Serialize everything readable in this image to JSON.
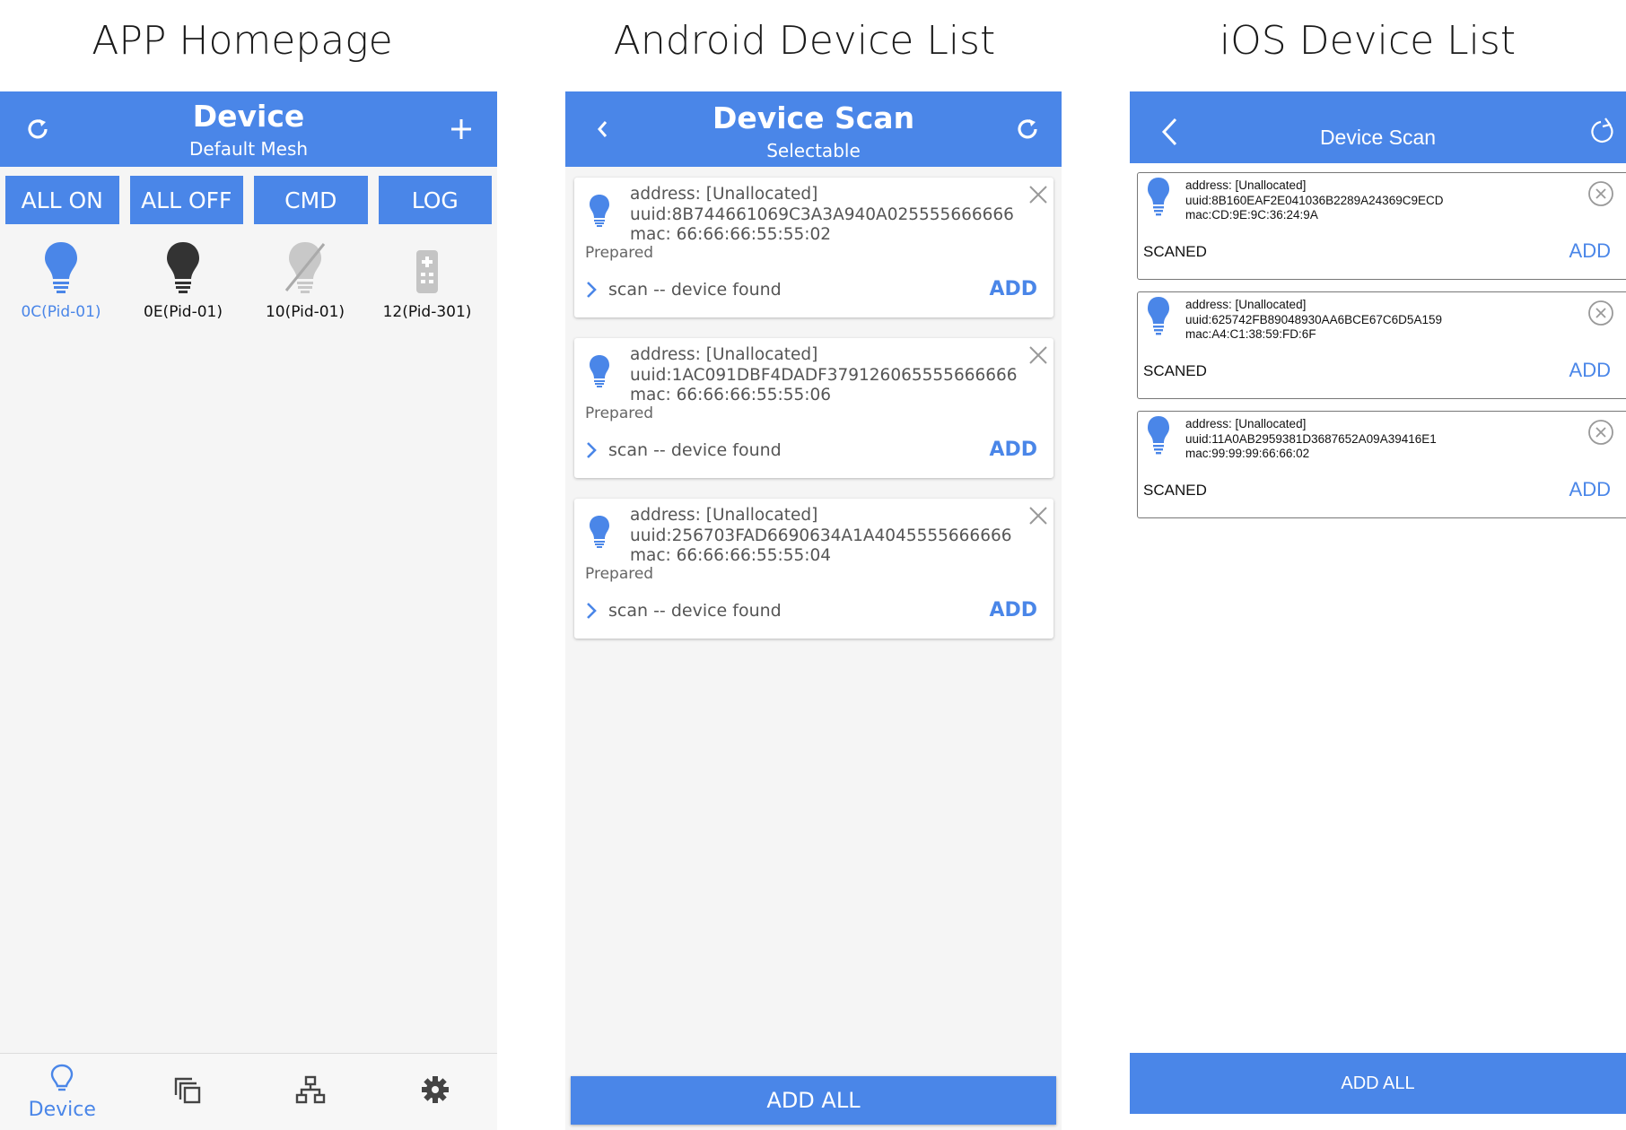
{
  "captions": {
    "homepage": "APP Homepage",
    "android": "Android Device List",
    "ios": "iOS Device List"
  },
  "colors": {
    "accent": "#4a86e8",
    "offline": "#bbbbbb",
    "off_bulb": "#333333"
  },
  "homepage": {
    "header": {
      "title": "Device",
      "subtitle": "Default Mesh",
      "left_icon": "refresh-icon",
      "right_icon": "plus-icon"
    },
    "buttons": [
      "ALL ON",
      "ALL OFF",
      "CMD",
      "LOG"
    ],
    "devices": [
      {
        "label": "0C(Pid-01)",
        "icon": "bulb-on-icon",
        "state": "on"
      },
      {
        "label": "0E(Pid-01)",
        "icon": "bulb-off-icon",
        "state": "off"
      },
      {
        "label": "10(Pid-01)",
        "icon": "bulb-offline-icon",
        "state": "offline"
      },
      {
        "label": "12(Pid-301)",
        "icon": "remote-icon",
        "state": "offline"
      }
    ],
    "tabs": [
      {
        "label": "Device",
        "icon": "bulb-outline-icon",
        "active": true
      },
      {
        "label": "",
        "icon": "group-icon",
        "active": false
      },
      {
        "label": "",
        "icon": "network-icon",
        "active": false
      },
      {
        "label": "",
        "icon": "gear-icon",
        "active": false
      }
    ]
  },
  "android": {
    "header": {
      "title": "Device Scan",
      "subtitle": "Selectable",
      "left_icon": "back-icon",
      "right_icon": "refresh-icon"
    },
    "devices": [
      {
        "address": "address: [Unallocated]",
        "uuid": "uuid:8B744661069C3A3A940A025555666666",
        "mac": "mac: 66:66:66:55:55:02",
        "state": "Prepared",
        "status": "scan -- device found",
        "action": "ADD"
      },
      {
        "address": "address: [Unallocated]",
        "uuid": "uuid:1AC091DBF4DADF379126065555666666",
        "mac": "mac: 66:66:66:55:55:06",
        "state": "Prepared",
        "status": "scan -- device found",
        "action": "ADD"
      },
      {
        "address": "address: [Unallocated]",
        "uuid": "uuid:256703FAD6690634A1A4045555666666",
        "mac": "mac: 66:66:66:55:55:04",
        "state": "Prepared",
        "status": "scan -- device found",
        "action": "ADD"
      }
    ],
    "add_all": "ADD ALL"
  },
  "ios": {
    "header": {
      "title": "Device Scan",
      "left_icon": "back-icon",
      "right_icon": "refresh-icon"
    },
    "devices": [
      {
        "address": "address: [Unallocated]",
        "uuid": "uuid:8B160EAF2E041036B2289A24369C9ECD",
        "mac": "mac:CD:9E:9C:36:24:9A",
        "state": "SCANED",
        "action": "ADD"
      },
      {
        "address": "address: [Unallocated]",
        "uuid": "uuid:625742FB89048930AA6BCE67C6D5A159",
        "mac": "mac:A4:C1:38:59:FD:6F",
        "state": "SCANED",
        "action": "ADD"
      },
      {
        "address": "address: [Unallocated]",
        "uuid": "uuid:11A0AB2959381D3687652A09A39416E1",
        "mac": "mac:99:99:99:66:66:02",
        "state": "SCANED",
        "action": "ADD"
      }
    ],
    "add_all": "ADD ALL"
  }
}
